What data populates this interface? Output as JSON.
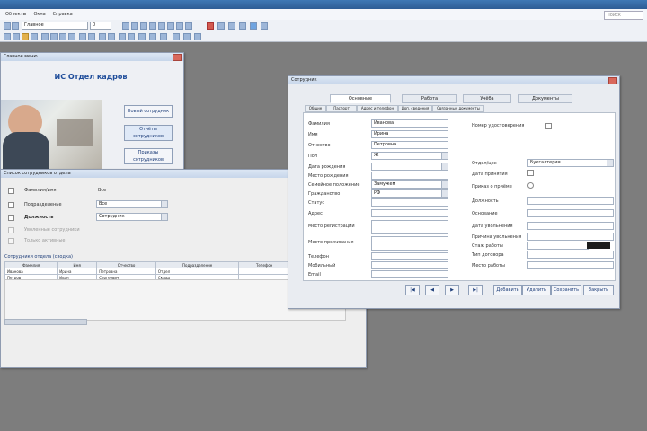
{
  "app": {
    "search_placeholder": "Поиск"
  },
  "menu": [
    "Объекты",
    "Окна",
    "Справка"
  ],
  "toolbar": {
    "combo_value": "Главное",
    "small_combo": "0"
  },
  "welcome_window": {
    "title": "Главное меню",
    "heading": "ИС Отдел кадров",
    "buttons": [
      "Новый сотрудник",
      "Отчёты сотрудников",
      "Приказы сотрудников"
    ]
  },
  "employees_window": {
    "title": "Список сотрудников отдела",
    "filters": [
      {
        "label": "Фамилия/имя",
        "value": "Все",
        "checked": true
      },
      {
        "label": "Подразделение",
        "value": "Все",
        "checked": true
      },
      {
        "label": "Должность",
        "value": "Сотрудник",
        "checked": true
      },
      {
        "label": "Уволенные сотрудники",
        "value": "",
        "checked": false
      },
      {
        "label": "Только активные",
        "value": "",
        "checked": false
      }
    ],
    "grid_caption": "Сотрудники отдела (сводка)",
    "columns": [
      "Фамилия",
      "Имя",
      "Отчество",
      "Подразделение",
      "Телефон"
    ],
    "rows": [
      [
        "Иванова",
        "Ирина",
        "Петровна",
        "Отдел",
        ""
      ],
      [
        "Петров",
        "Иван",
        "Сергеевич",
        "Склад",
        ""
      ]
    ]
  },
  "card_window": {
    "title": "Сотрудник",
    "tabs": [
      "Основные",
      "Работа",
      "Учёба",
      "Документы"
    ],
    "subtabs": [
      "Общие",
      "Паспорт",
      "Адрес и телефон",
      "Доп. сведения",
      "Связанные документы"
    ],
    "left_labels": [
      "Фамилия",
      "Имя",
      "Отчество",
      "Пол",
      "Дата рождения",
      "Место рождения",
      "Семейное положение",
      "Гражданство",
      "Статус",
      "Адрес",
      "Место регистрации",
      "",
      "Место проживания",
      "",
      "Телефон",
      "Мобильный",
      "Email"
    ],
    "left_values": [
      "Иванова",
      "Ирина",
      "Петровна",
      "Ж",
      "",
      "",
      "Замужем",
      "РФ",
      "",
      "",
      "",
      "",
      "",
      "",
      "",
      "",
      ""
    ],
    "right_labels": [
      "Номер удостоверения",
      "Отдел/цех",
      "Дата принятия",
      "Приказ о приёме",
      "Должность",
      "Основание",
      "Дата увольнения",
      "Причина увольнения",
      "Стаж работы",
      "Тип договора",
      "Место работы"
    ],
    "right_values": [
      "",
      "Бухгалтерия",
      "",
      "",
      "",
      "",
      "",
      "",
      "",
      "",
      ""
    ],
    "nav_buttons": [
      "|◀",
      "◀",
      "▶",
      "▶|"
    ],
    "action_buttons": [
      "Добавить",
      "Удалить",
      "Сохранить",
      "Закрыть"
    ]
  }
}
